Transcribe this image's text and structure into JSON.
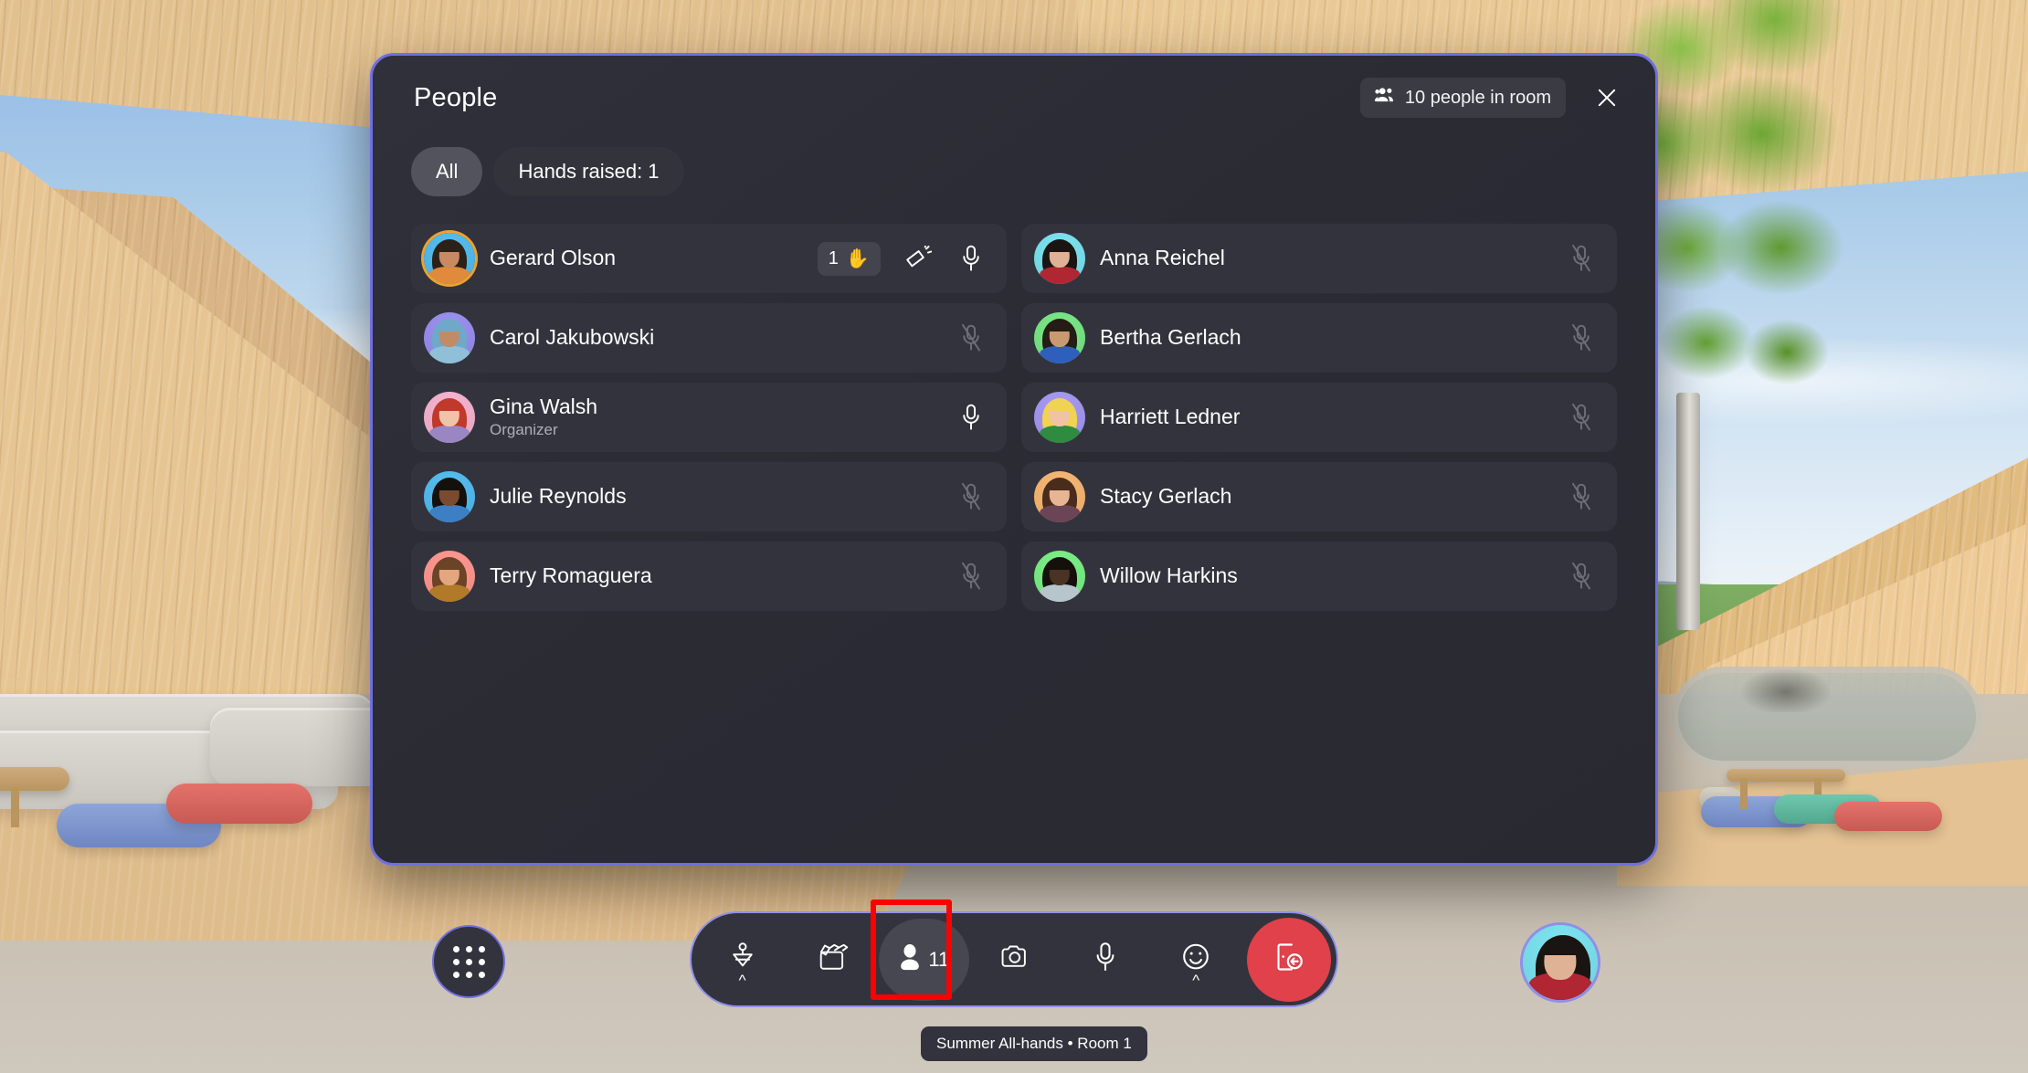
{
  "panel": {
    "title": "People",
    "room_count_label": "10 people in room",
    "room_count_icon": "people-icon",
    "close_icon": "close-icon",
    "filters": [
      {
        "label": "All",
        "selected": true
      },
      {
        "label": "Hands raised: 1",
        "selected": false
      }
    ]
  },
  "people": [
    {
      "name": "Gerard Olson",
      "role": "",
      "mic": "unmuted",
      "hand_raised": true,
      "hand_order": "1",
      "hand_emoji": "✋",
      "has_megaphone": true,
      "avatar_ring": true,
      "avatar": {
        "bg": "#58bff0",
        "skin": "#c98a63",
        "hair": "#2b2118",
        "clothes": "#e08a3c"
      }
    },
    {
      "name": "Anna Reichel",
      "role": "",
      "mic": "muted",
      "hand_raised": false,
      "has_megaphone": false,
      "avatar_ring": false,
      "avatar": {
        "bg": "#7fe3f0",
        "skin": "#e0b295",
        "hair": "#1a1512",
        "clothes": "#b02633"
      }
    },
    {
      "name": "Carol Jakubowski",
      "role": "",
      "mic": "muted",
      "hand_raised": false,
      "has_megaphone": false,
      "avatar_ring": false,
      "avatar": {
        "bg": "#9d92f0",
        "skin": "#c08b66",
        "hair": "#6fa9c9",
        "clothes": "#8fc0d8"
      }
    },
    {
      "name": "Bertha Gerlach",
      "role": "",
      "mic": "muted",
      "hand_raised": false,
      "has_megaphone": false,
      "avatar_ring": false,
      "avatar": {
        "bg": "#7de88a",
        "skin": "#c99a72",
        "hair": "#241c15",
        "clothes": "#2f5fbd"
      }
    },
    {
      "name": "Gina Walsh",
      "role": "Organizer",
      "mic": "unmuted",
      "hand_raised": false,
      "has_megaphone": false,
      "avatar_ring": false,
      "avatar": {
        "bg": "#f6b6d2",
        "skin": "#f0c4a8",
        "hair": "#c0392b",
        "clothes": "#9b86c4"
      }
    },
    {
      "name": "Harriett Ledner",
      "role": "",
      "mic": "muted",
      "hand_raised": false,
      "has_megaphone": false,
      "avatar_ring": false,
      "avatar": {
        "bg": "#a89bf2",
        "skin": "#f0c3a4",
        "hair": "#f0d255",
        "clothes": "#2e8b3f"
      }
    },
    {
      "name": "Julie Reynolds",
      "role": "",
      "mic": "muted",
      "hand_raised": false,
      "has_megaphone": false,
      "avatar_ring": false,
      "avatar": {
        "bg": "#58bff0",
        "skin": "#7a4b2e",
        "hair": "#14100c",
        "clothes": "#3d7fc4"
      }
    },
    {
      "name": "Stacy Gerlach",
      "role": "",
      "mic": "muted",
      "hand_raised": false,
      "has_megaphone": false,
      "avatar_ring": false,
      "avatar": {
        "bg": "#f7b978",
        "skin": "#e8b594",
        "hair": "#4a2c1c",
        "clothes": "#6b4455"
      }
    },
    {
      "name": "Terry Romaguera",
      "role": "",
      "mic": "muted",
      "hand_raised": false,
      "has_megaphone": false,
      "avatar_ring": false,
      "avatar": {
        "bg": "#ff9a92",
        "skin": "#e4a67f",
        "hair": "#6b4327",
        "clothes": "#b07a28"
      }
    },
    {
      "name": "Willow Harkins",
      "role": "",
      "mic": "muted",
      "hand_raised": false,
      "has_megaphone": false,
      "avatar_ring": false,
      "avatar": {
        "bg": "#7ef08a",
        "skin": "#4a3224",
        "hair": "#15100c",
        "clothes": "#b7c5cc"
      }
    }
  ],
  "toolbar": {
    "apps_button_icon": "apps-grid-icon",
    "tools": [
      {
        "icon": "raise-hand-icon",
        "label": "Raise hand",
        "has_chevron": true,
        "active": false,
        "count": ""
      },
      {
        "icon": "share-content-icon",
        "label": "Share",
        "has_chevron": false,
        "active": false,
        "count": ""
      },
      {
        "icon": "people-icon",
        "label": "People",
        "has_chevron": false,
        "active": true,
        "count": "11"
      },
      {
        "icon": "camera-icon",
        "label": "Camera",
        "has_chevron": false,
        "active": false,
        "count": ""
      },
      {
        "icon": "microphone-icon",
        "label": "Microphone",
        "has_chevron": false,
        "active": false,
        "count": ""
      },
      {
        "icon": "reactions-icon",
        "label": "Reactions",
        "has_chevron": true,
        "active": false,
        "count": ""
      }
    ],
    "leave": {
      "icon": "leave-room-icon",
      "label": "Leave",
      "color": "#e0414a"
    },
    "tooltip": "Summer All-hands • Room 1",
    "self_avatar": {
      "name": "self-avatar",
      "bg": "#7fe3f0",
      "skin": "#e0b295",
      "hair": "#1a1512",
      "clothes": "#b02633"
    }
  },
  "colors": {
    "panel_border": "#6f6fe0",
    "panel_bg": "#2b2b34",
    "row_bg": "#33333d",
    "accent_ring": "#eda22c",
    "leave_red": "#e0414a",
    "highlight_red": "#ff0000"
  }
}
